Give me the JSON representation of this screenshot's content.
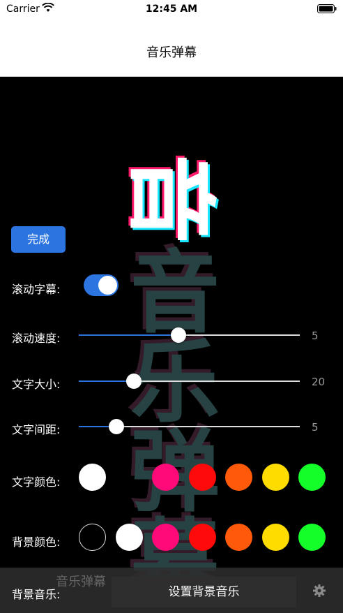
{
  "status_bar": {
    "carrier": "Carrier",
    "time": "12:45 AM"
  },
  "nav": {
    "title": "音乐弹幕"
  },
  "marquee": {
    "text_chars": [
      "啦",
      "音",
      "乐",
      "弹",
      "幕"
    ],
    "ghost_chars": [
      "音",
      "乐",
      "弹",
      "幕"
    ]
  },
  "controls": {
    "done_label": "完成",
    "scroll_label": "滚动字幕:",
    "scroll_enabled": true,
    "speed_label": "滚动速度:",
    "speed_value": "5",
    "speed_fraction": 0.45,
    "size_label": "文字大小:",
    "size_value": "20",
    "size_fraction": 0.25,
    "spacing_label": "文字间距:",
    "spacing_value": "5",
    "spacing_fraction": 0.17,
    "text_color_label": "文字颜色:",
    "text_colors": [
      "#ffffff",
      "#ff0a78",
      "#ff0a0a",
      "#ff5a0a",
      "#ffdc00",
      "#14ff2a"
    ],
    "bg_color_label": "背景颜色:",
    "bg_colors": [
      "#000000",
      "#ffffff",
      "#ff0a78",
      "#ff0a0a",
      "#ff5a0a",
      "#ffdc00",
      "#14ff2a"
    ]
  },
  "bottom": {
    "ghost_text": "音乐弹幕",
    "label": "背景音乐:",
    "button_label": "设置背景音乐"
  }
}
